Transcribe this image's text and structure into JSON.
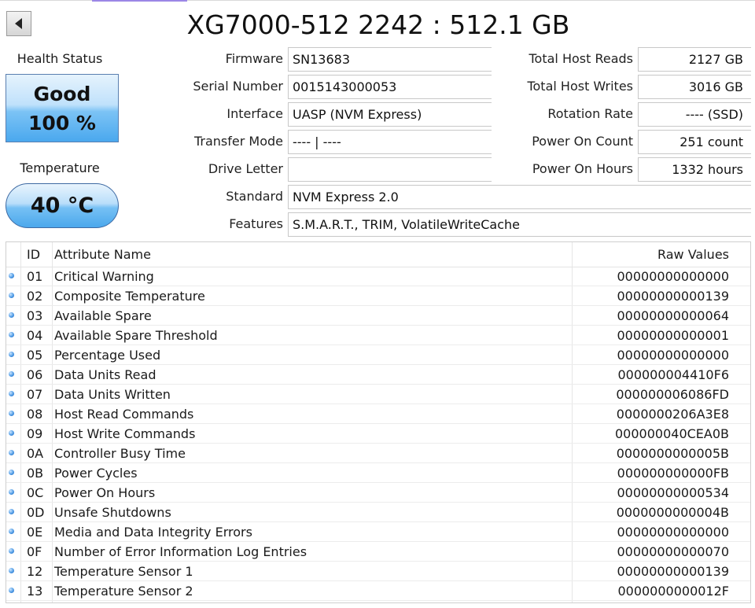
{
  "header": {
    "title": "XG7000-512 2242 : 512.1 GB",
    "back_icon": "left-arrow-icon"
  },
  "health": {
    "label": "Health Status",
    "status": "Good",
    "percent": "100 %"
  },
  "temperature": {
    "label": "Temperature",
    "value": "40 °C"
  },
  "fields": {
    "firmware": {
      "label": "Firmware",
      "value": "SN13683"
    },
    "serial": {
      "label": "Serial Number",
      "value": "0015143000053"
    },
    "interface": {
      "label": "Interface",
      "value": "UASP (NVM Express)"
    },
    "transfer_mode": {
      "label": "Transfer Mode",
      "value": "---- | ----"
    },
    "drive_letter": {
      "label": "Drive Letter",
      "value": ""
    },
    "standard": {
      "label": "Standard",
      "value": "NVM Express 2.0"
    },
    "features": {
      "label": "Features",
      "value": "S.M.A.R.T., TRIM, VolatileWriteCache"
    },
    "total_host_reads": {
      "label": "Total Host Reads",
      "value": "2127 GB"
    },
    "total_host_writes": {
      "label": "Total Host Writes",
      "value": "3016 GB"
    },
    "rotation_rate": {
      "label": "Rotation Rate",
      "value": "---- (SSD)"
    },
    "power_on_count": {
      "label": "Power On Count",
      "value": "251 count"
    },
    "power_on_hours": {
      "label": "Power On Hours",
      "value": "1332 hours"
    }
  },
  "table": {
    "columns": {
      "id": "ID",
      "name": "Attribute Name",
      "raw": "Raw Values"
    },
    "rows": [
      {
        "id": "01",
        "name": "Critical Warning",
        "raw": "00000000000000"
      },
      {
        "id": "02",
        "name": "Composite Temperature",
        "raw": "00000000000139"
      },
      {
        "id": "03",
        "name": "Available Spare",
        "raw": "00000000000064"
      },
      {
        "id": "04",
        "name": "Available Spare Threshold",
        "raw": "00000000000001"
      },
      {
        "id": "05",
        "name": "Percentage Used",
        "raw": "00000000000000"
      },
      {
        "id": "06",
        "name": "Data Units Read",
        "raw": "000000004410F6"
      },
      {
        "id": "07",
        "name": "Data Units Written",
        "raw": "000000006086FD"
      },
      {
        "id": "08",
        "name": "Host Read Commands",
        "raw": "0000000206A3E8"
      },
      {
        "id": "09",
        "name": "Host Write Commands",
        "raw": "000000040CEA0B"
      },
      {
        "id": "0A",
        "name": "Controller Busy Time",
        "raw": "0000000000005B"
      },
      {
        "id": "0B",
        "name": "Power Cycles",
        "raw": "000000000000FB"
      },
      {
        "id": "0C",
        "name": "Power On Hours",
        "raw": "00000000000534"
      },
      {
        "id": "0D",
        "name": "Unsafe Shutdowns",
        "raw": "0000000000004B"
      },
      {
        "id": "0E",
        "name": "Media and Data Integrity Errors",
        "raw": "00000000000000"
      },
      {
        "id": "0F",
        "name": "Number of Error Information Log Entries",
        "raw": "00000000000070"
      },
      {
        "id": "12",
        "name": "Temperature Sensor 1",
        "raw": "00000000000139"
      },
      {
        "id": "13",
        "name": "Temperature Sensor 2",
        "raw": "0000000000012F"
      }
    ]
  },
  "colors": {
    "status_good": "#4aa8ee",
    "accent": "#9b87e6"
  }
}
